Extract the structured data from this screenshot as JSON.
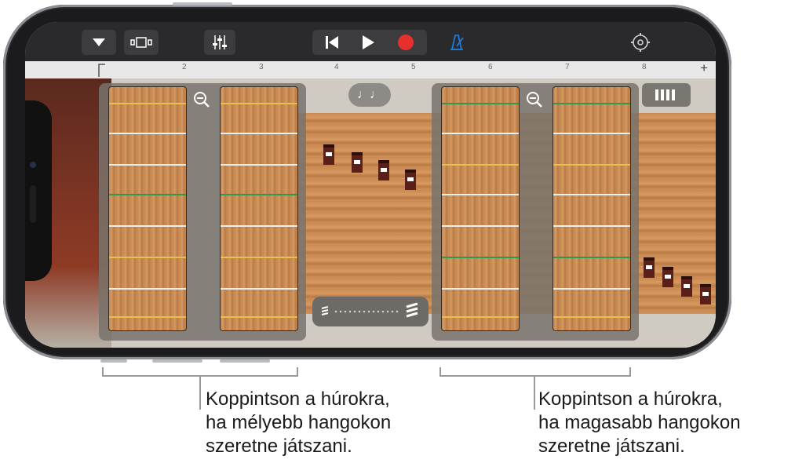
{
  "toolbar": {
    "buttons": [
      {
        "name": "browser-menu-button",
        "icon": "triangle-down-icon"
      },
      {
        "name": "view-toggle-button",
        "icon": "tracks-view-icon"
      },
      {
        "name": "mixer-button",
        "icon": "sliders-icon"
      },
      {
        "name": "go-to-beginning-button",
        "icon": "skip-back-icon"
      },
      {
        "name": "play-button",
        "icon": "play-icon"
      },
      {
        "name": "record-button",
        "icon": "record-icon"
      },
      {
        "name": "metronome-button",
        "icon": "metronome-icon"
      },
      {
        "name": "settings-button",
        "icon": "gear-icon"
      }
    ],
    "colors": {
      "record": "#e5302b",
      "metronome": "#1e7bd6"
    }
  },
  "ruler": {
    "marks": [
      "2",
      "3",
      "4",
      "5",
      "6",
      "7",
      "8"
    ],
    "plus": "+"
  },
  "instrument": {
    "notes_button": "♩♩",
    "left_panel": "low-strings",
    "right_panel": "high-strings"
  },
  "callouts": {
    "left": "Koppintson a húrokra,\nha mélyebb hangokon\nszeretne játszani.",
    "right": "Koppintson a húrokra,\nha magasabb hangokon\nszeretne játszani."
  }
}
